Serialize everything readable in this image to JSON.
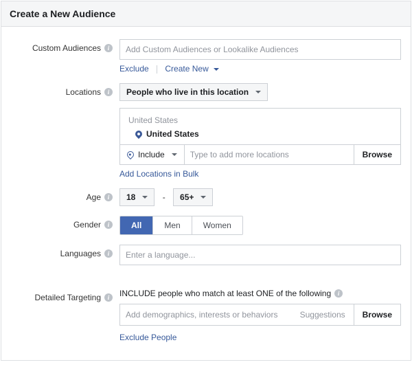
{
  "header": {
    "title": "Create a New Audience"
  },
  "customAudiences": {
    "label": "Custom Audiences",
    "placeholder": "Add Custom Audiences or Lookalike Audiences",
    "excludeLink": "Exclude",
    "createNewLink": "Create New"
  },
  "locations": {
    "label": "Locations",
    "selectorValue": "People who live in this location",
    "groupLabel": "United States",
    "selectedItem": "United States",
    "includeLabel": "Include",
    "inputPlaceholder": "Type to add more locations",
    "browseLabel": "Browse",
    "bulkLink": "Add Locations in Bulk"
  },
  "age": {
    "label": "Age",
    "min": "18",
    "max": "65+",
    "dash": "-"
  },
  "gender": {
    "label": "Gender",
    "options": {
      "all": "All",
      "men": "Men",
      "women": "Women"
    }
  },
  "languages": {
    "label": "Languages",
    "placeholder": "Enter a language..."
  },
  "detailedTargeting": {
    "label": "Detailed Targeting",
    "heading": "INCLUDE people who match at least ONE of the following",
    "placeholder": "Add demographics, interests or behaviors",
    "suggestions": "Suggestions",
    "browse": "Browse",
    "excludeLink": "Exclude People"
  }
}
